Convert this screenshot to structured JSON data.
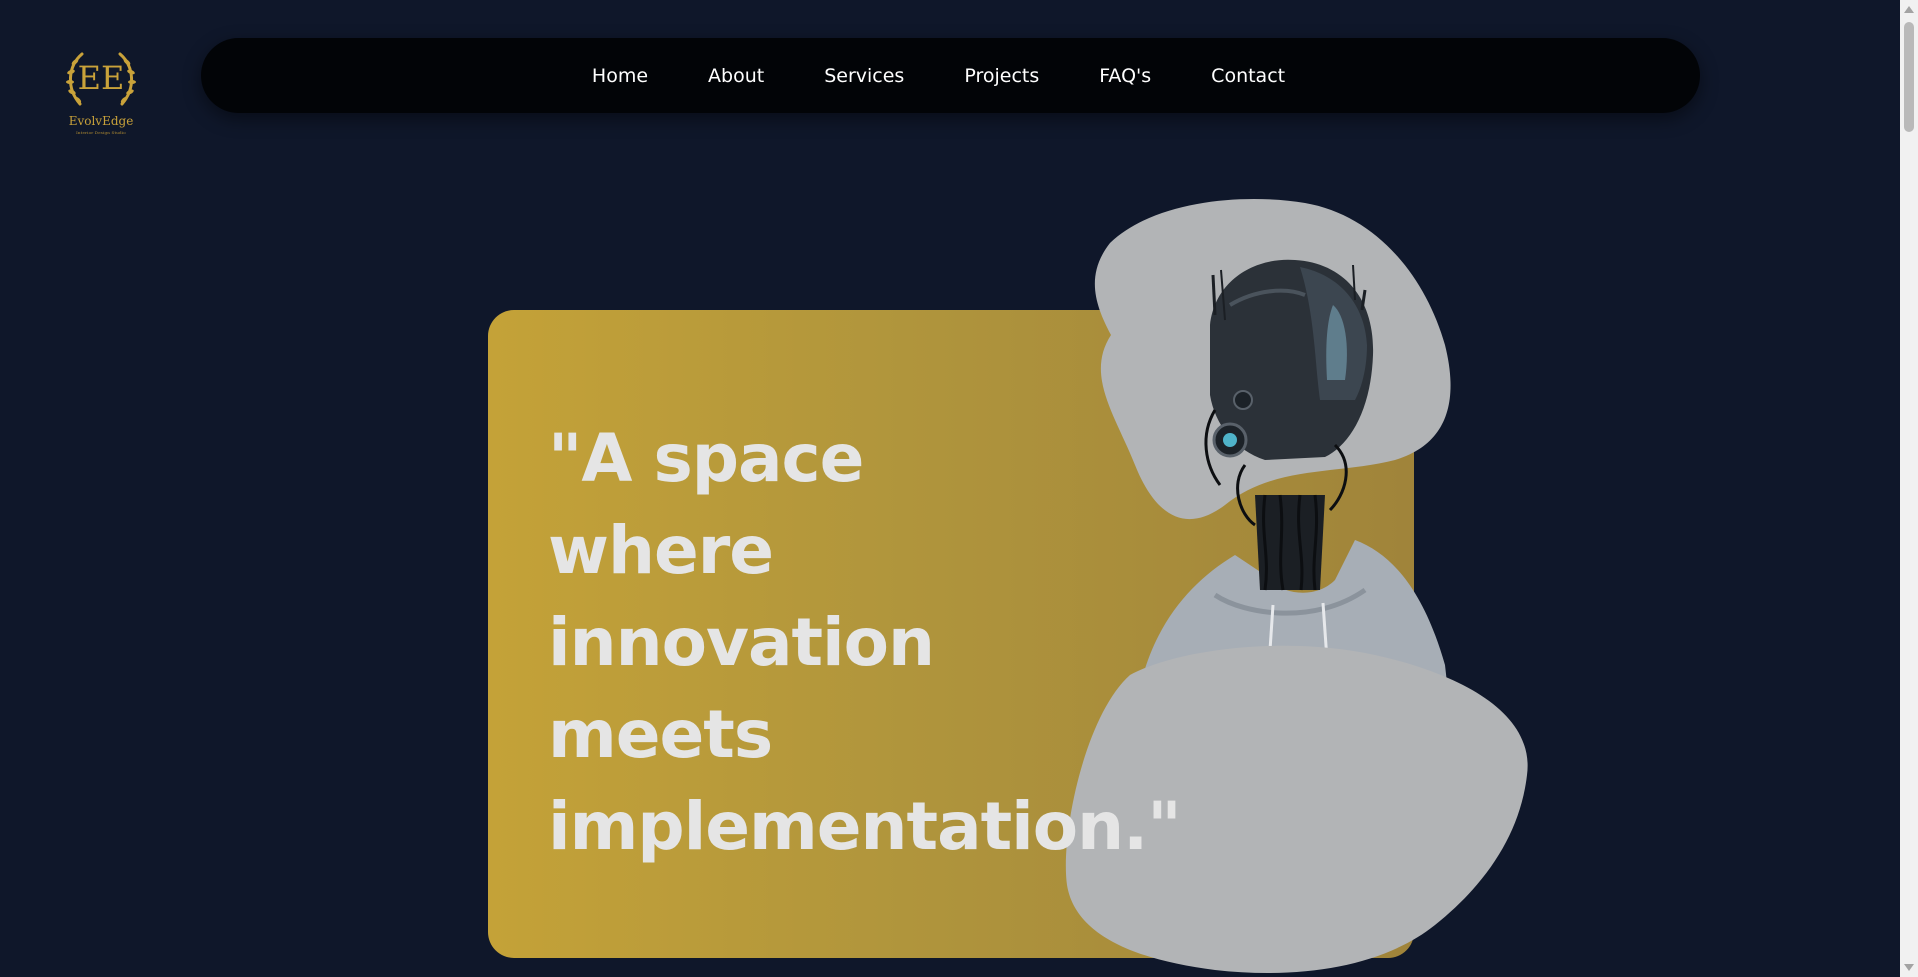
{
  "brand": {
    "name": "EvolvEdge",
    "monogram": "EE",
    "tagline": "Interior Design Studio",
    "accent_color": "#c9a23a"
  },
  "nav": {
    "items": [
      {
        "label": "Home"
      },
      {
        "label": "About"
      },
      {
        "label": "Services"
      },
      {
        "label": "Projects"
      },
      {
        "label": "FAQ's"
      },
      {
        "label": "Contact"
      }
    ]
  },
  "hero": {
    "quote_lines": [
      "\"A space",
      "where",
      "innovation",
      "meets",
      "implementation.\""
    ],
    "card_gradient": [
      "#c4a238",
      "#a0843a"
    ],
    "blob_color": "#b2b4b6",
    "image": "robot-head-in-hoodie"
  },
  "colors": {
    "background": "#0f172a",
    "navbar": "#020407",
    "text": "#e5e5e5"
  }
}
